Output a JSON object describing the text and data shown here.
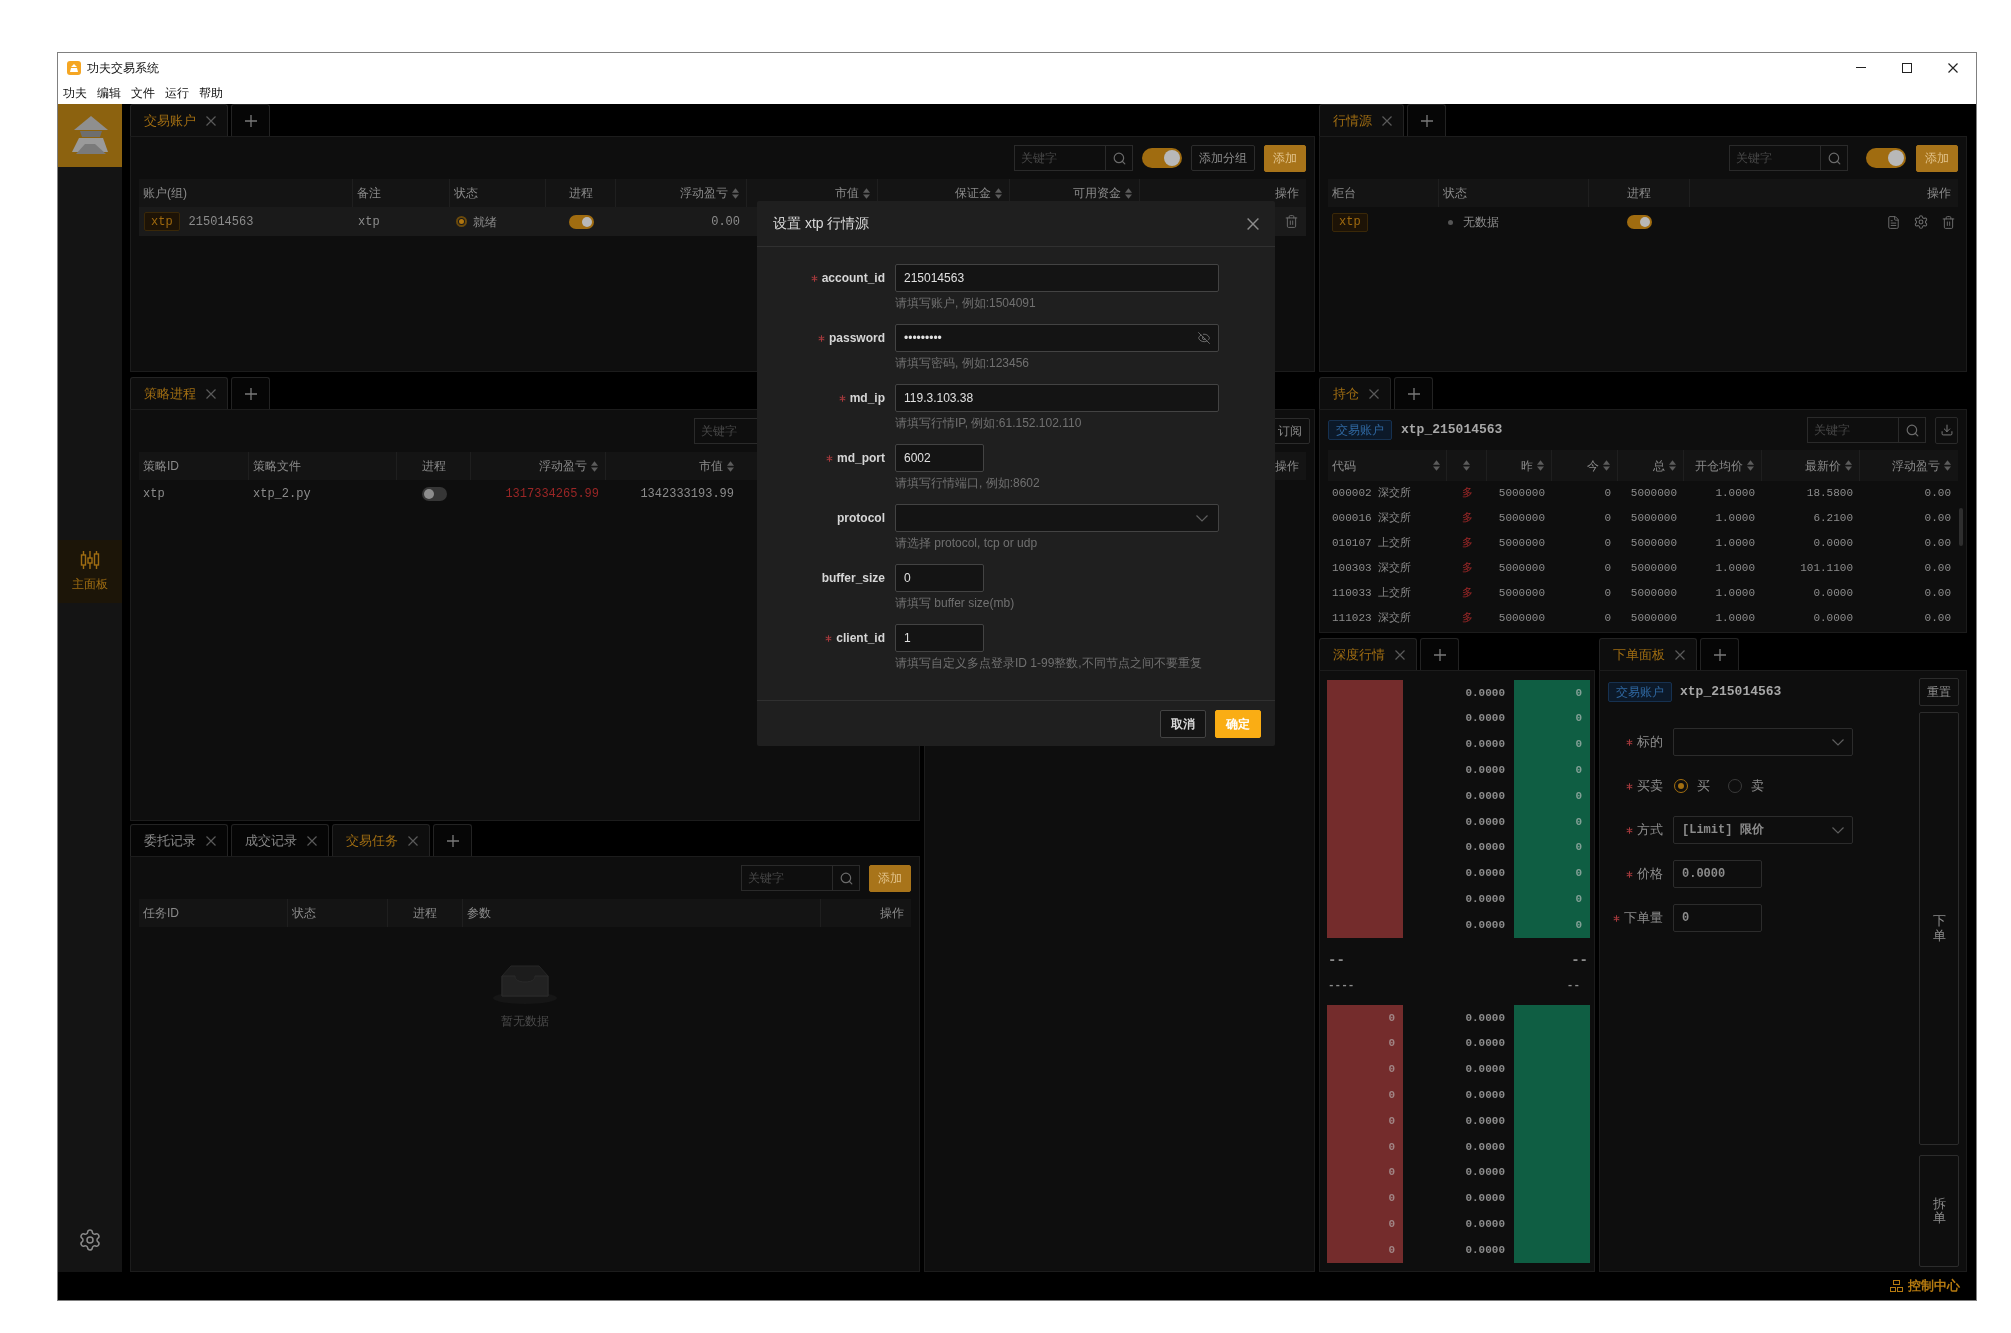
{
  "window": {
    "title": "功夫交易系统",
    "menu": [
      "功夫",
      "编辑",
      "文件",
      "运行",
      "帮助"
    ]
  },
  "sidebar": {
    "items": [
      {
        "label": "主面板",
        "selected": true
      }
    ]
  },
  "accounts_panel": {
    "tabs": [
      {
        "label": "交易账户",
        "selected": true
      }
    ],
    "search": {
      "placeholder": "关键字"
    },
    "switch": {
      "on": true
    },
    "buttons": [
      {
        "label": "添加分组",
        "kind": "default"
      },
      {
        "label": "添加",
        "kind": "primary"
      }
    ],
    "columns": [
      {
        "label": "账户(组)",
        "sortable": false
      },
      {
        "label": "备注",
        "sortable": false
      },
      {
        "label": "状态",
        "sortable": false
      },
      {
        "label": "进程",
        "sortable": false
      },
      {
        "label": "浮动盈亏",
        "sortable": true
      },
      {
        "label": "市值",
        "sortable": true
      },
      {
        "label": "保证金",
        "sortable": true
      },
      {
        "label": "可用资金",
        "sortable": true
      },
      {
        "label": "操作",
        "sortable": false
      }
    ],
    "rows": [
      {
        "selected": true,
        "source": "xtp",
        "account": "215014563",
        "note": "xtp",
        "status": {
          "label": "就绪",
          "kind": "ready"
        },
        "process_on": true,
        "pnl": "0.00"
      }
    ]
  },
  "strategy_panel": {
    "tabs": [
      {
        "label": "策略进程",
        "selected": true
      }
    ],
    "search": {
      "placeholder": "关键字"
    },
    "columns": [
      {
        "label": "策略ID",
        "sortable": false
      },
      {
        "label": "策略文件",
        "sortable": false
      },
      {
        "label": "进程",
        "sortable": false
      },
      {
        "label": "浮动盈亏",
        "sortable": true
      },
      {
        "label": "市值",
        "sortable": true
      }
    ],
    "rows": [
      {
        "id": "xtp",
        "file": "xtp_2.py",
        "process_on": false,
        "pnl": "1317334265.99",
        "market_value": "1342333193.99"
      }
    ]
  },
  "middle_panel": {
    "buttons": [
      {
        "label": "订阅",
        "kind": "default"
      }
    ],
    "columns": [
      {
        "label": "操作",
        "sortable": false
      }
    ]
  },
  "tasks_panel": {
    "tabs": [
      {
        "label": "委托记录",
        "selected": false
      },
      {
        "label": "成交记录",
        "selected": false
      },
      {
        "label": "交易任务",
        "selected": true
      }
    ],
    "search": {
      "placeholder": "关键字"
    },
    "buttons": [
      {
        "label": "添加",
        "kind": "primary"
      }
    ],
    "columns": [
      {
        "label": "任务ID",
        "sortable": false
      },
      {
        "label": "状态",
        "sortable": false
      },
      {
        "label": "进程",
        "sortable": false
      },
      {
        "label": "参数",
        "sortable": false
      },
      {
        "label": "操作",
        "sortable": false
      }
    ],
    "empty_text": "暂无数据"
  },
  "market_source_panel": {
    "tabs": [
      {
        "label": "行情源",
        "selected": true
      }
    ],
    "search": {
      "placeholder": "关键字"
    },
    "switch": {
      "on": true
    },
    "buttons": [
      {
        "label": "添加",
        "kind": "primary"
      }
    ],
    "columns": [
      {
        "label": "柜台",
        "sortable": false
      },
      {
        "label": "状态",
        "sortable": false
      },
      {
        "label": "进程",
        "sortable": false
      },
      {
        "label": "操作",
        "sortable": false
      }
    ],
    "rows": [
      {
        "source": "xtp",
        "status": {
          "label": "无数据",
          "kind": "idle"
        },
        "process_on": true
      }
    ]
  },
  "positions_panel": {
    "tabs": [
      {
        "label": "持仓",
        "selected": true
      }
    ],
    "account_tag": "交易账户",
    "account": "xtp_215014563",
    "search": {
      "placeholder": "关键字"
    },
    "columns": [
      {
        "label": "代码",
        "sortable": true
      },
      {
        "sortable": true
      },
      {
        "label": "昨",
        "sortable": true
      },
      {
        "label": "今",
        "sortable": true
      },
      {
        "label": "总",
        "sortable": true
      },
      {
        "label": "开仓均价",
        "sortable": true
      },
      {
        "label": "最新价",
        "sortable": true
      },
      {
        "label": "浮动盈亏",
        "sortable": true
      }
    ],
    "rows": [
      {
        "cells": [
          "000002 深交所",
          "多",
          "5000000",
          "0",
          "5000000",
          "1.0000",
          "18.5800",
          "0.00"
        ]
      },
      {
        "cells": [
          "000016 深交所",
          "多",
          "5000000",
          "0",
          "5000000",
          "1.0000",
          "6.2100",
          "0.00"
        ]
      },
      {
        "cells": [
          "010107 上交所",
          "多",
          "5000000",
          "0",
          "5000000",
          "1.0000",
          "0.0000",
          "0.00"
        ]
      },
      {
        "cells": [
          "100303 深交所",
          "多",
          "5000000",
          "0",
          "5000000",
          "1.0000",
          "101.1100",
          "0.00"
        ]
      },
      {
        "cells": [
          "110033 上交所",
          "多",
          "5000000",
          "0",
          "5000000",
          "1.0000",
          "0.0000",
          "0.00"
        ]
      },
      {
        "cells": [
          "111023 深交所",
          "多",
          "5000000",
          "0",
          "5000000",
          "1.0000",
          "0.0000",
          "0.00"
        ]
      }
    ]
  },
  "depth_panel": {
    "tabs": [
      {
        "label": "深度行情",
        "selected": true
      }
    ],
    "asks": [
      {
        "price": "0.0000",
        "volume": "0"
      },
      {
        "price": "0.0000",
        "volume": "0"
      },
      {
        "price": "0.0000",
        "volume": "0"
      },
      {
        "price": "0.0000",
        "volume": "0"
      },
      {
        "price": "0.0000",
        "volume": "0"
      },
      {
        "price": "0.0000",
        "volume": "0"
      },
      {
        "price": "0.0000",
        "volume": "0"
      },
      {
        "price": "0.0000",
        "volume": "0"
      },
      {
        "price": "0.0000",
        "volume": "0"
      },
      {
        "price": "0.0000",
        "volume": "0"
      }
    ],
    "mid": [
      {
        "left": "--",
        "right": "--"
      },
      {
        "left": "----",
        "right": "--"
      }
    ],
    "bids": [
      {
        "volume": "0",
        "price": "0.0000"
      },
      {
        "volume": "0",
        "price": "0.0000"
      },
      {
        "volume": "0",
        "price": "0.0000"
      },
      {
        "volume": "0",
        "price": "0.0000"
      },
      {
        "volume": "0",
        "price": "0.0000"
      },
      {
        "volume": "0",
        "price": "0.0000"
      },
      {
        "volume": "0",
        "price": "0.0000"
      },
      {
        "volume": "0",
        "price": "0.0000"
      },
      {
        "volume": "0",
        "price": "0.0000"
      },
      {
        "volume": "0",
        "price": "0.0000"
      }
    ]
  },
  "order_panel": {
    "tabs": [
      {
        "label": "下单面板",
        "selected": true
      }
    ],
    "account_tag": "交易账户",
    "account": "xtp_215014563",
    "reset_button": "重置",
    "fields": [
      {
        "label": "标的",
        "required": true,
        "kind": "select"
      },
      {
        "label": "买卖",
        "required": true,
        "kind": "radio",
        "options": [
          {
            "label": "买",
            "selected": true
          },
          {
            "label": "卖",
            "selected": false
          }
        ]
      },
      {
        "label": "方式",
        "required": true,
        "kind": "select",
        "value": "[Limit] 限价"
      },
      {
        "label": "价格",
        "required": true,
        "kind": "input",
        "value": "0.0000"
      },
      {
        "label": "下单量",
        "required": true,
        "kind": "input",
        "value": "0"
      }
    ],
    "side_buttons": [
      {
        "label": "下单",
        "kind": "submit"
      },
      {
        "label": "拆单",
        "kind": "split"
      }
    ]
  },
  "status_bar": {
    "label": "控制中心"
  },
  "dialog": {
    "title": "设置 xtp 行情源",
    "fields": [
      {
        "label": "account_id",
        "required": true,
        "kind": "text",
        "value": "215014563",
        "help": "请填写账户, 例如:1504091"
      },
      {
        "label": "password",
        "required": true,
        "kind": "password",
        "value": "•••••••••",
        "help": "请填写密码, 例如:123456"
      },
      {
        "label": "md_ip",
        "required": true,
        "kind": "text",
        "value": "119.3.103.38",
        "help": "请填写行情IP, 例如:61.152.102.110"
      },
      {
        "label": "md_port",
        "required": true,
        "kind": "number",
        "value": "6002",
        "help": "请填写行情端口, 例如:8602"
      },
      {
        "label": "protocol",
        "required": false,
        "kind": "select",
        "help": "请选择 protocol, tcp or udp"
      },
      {
        "label": "buffer_size",
        "required": false,
        "kind": "number",
        "value": "0",
        "help": "请填写 buffer size(mb)"
      },
      {
        "label": "client_id",
        "required": true,
        "kind": "number",
        "value": "1",
        "help": "请填写自定义多点登录ID 1-99整数,不同节点之间不要重复"
      }
    ],
    "buttons": [
      {
        "label": "取消",
        "kind": "default"
      },
      {
        "label": "确定",
        "kind": "primary"
      }
    ]
  }
}
